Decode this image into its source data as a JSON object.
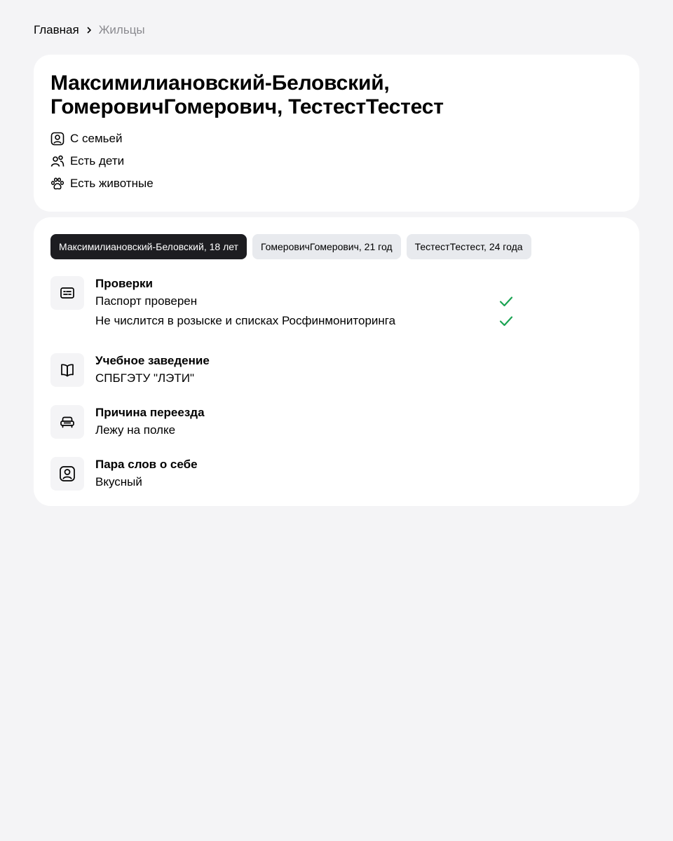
{
  "breadcrumb": {
    "home": "Главная",
    "current": "Жильцы"
  },
  "header": {
    "title": "Максимилиановский-Беловский, ГомеровичГомерович, ТестестТестест",
    "features": [
      {
        "icon": "user-card-icon",
        "label": "С семьей"
      },
      {
        "icon": "people-icon",
        "label": "Есть дети"
      },
      {
        "icon": "paw-icon",
        "label": "Есть животные"
      }
    ]
  },
  "residents": {
    "tabs": [
      {
        "label": "Максимилиановский-Беловский, 18 лет",
        "active": true
      },
      {
        "label": "ГомеровичГомерович, 21 год",
        "active": false
      },
      {
        "label": "ТестестТестест, 24 года",
        "active": false
      }
    ],
    "checks": {
      "icon": "document-icon",
      "title": "Проверки",
      "items": [
        {
          "label": "Паспорт проверен",
          "status": "checkmark-icon"
        },
        {
          "label": "Не числится в розыске и списках Росфинмониторинга",
          "status": "checkmark-icon"
        }
      ]
    },
    "education": {
      "icon": "book-icon",
      "title": "Учебное заведение",
      "value": "СПБГЭТУ \"ЛЭТИ\""
    },
    "move_reason": {
      "icon": "sofa-icon",
      "title": "Причина переезда",
      "value": "Лежу на полке"
    },
    "about": {
      "icon": "user-card-icon",
      "title": "Пара слов о себе",
      "value": "Вкусный"
    }
  },
  "colors": {
    "background": "#f4f4f6",
    "card": "#ffffff",
    "active_tab": "#1d1d21",
    "inactive_tab": "#e8eaee",
    "check_green": "#1aa352",
    "muted_text": "#8a8a8f"
  }
}
